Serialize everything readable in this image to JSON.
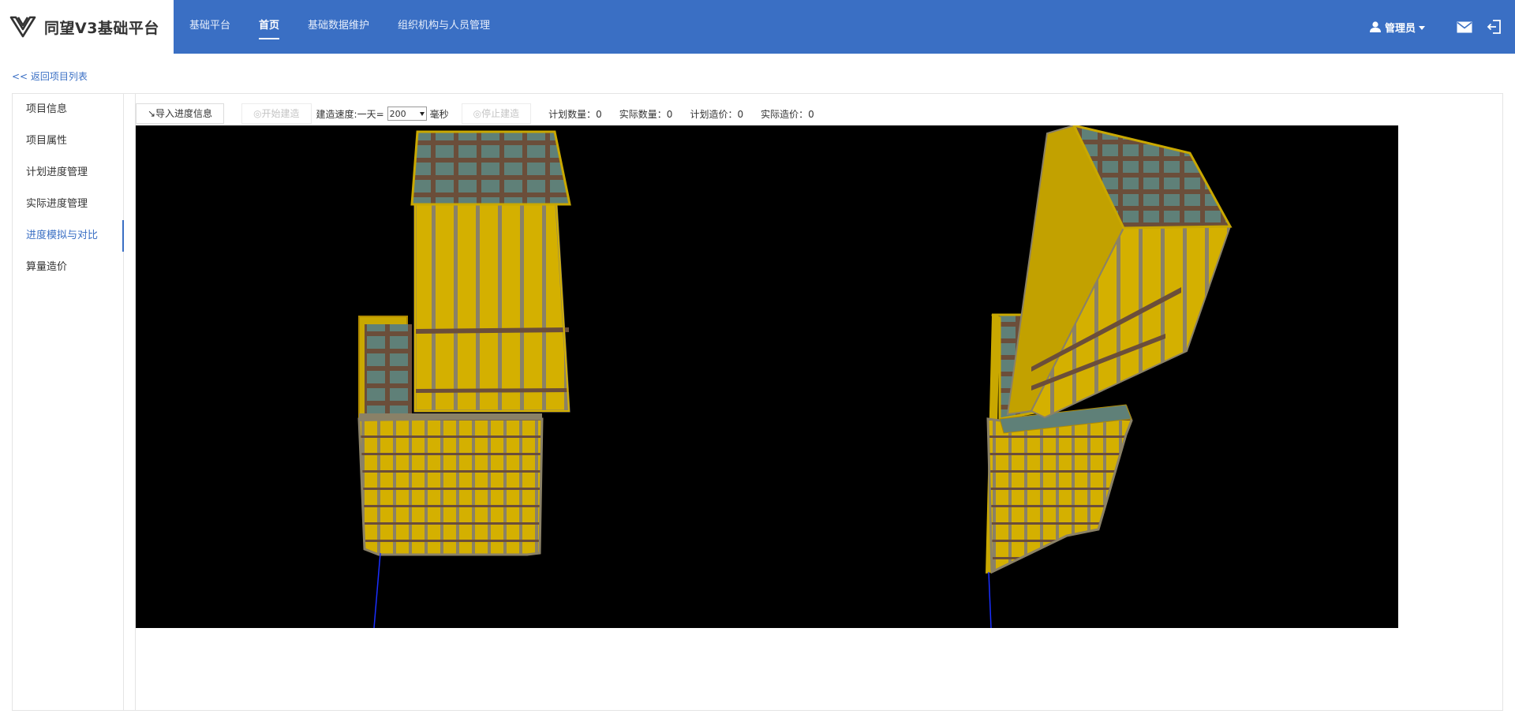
{
  "app": {
    "title": "同望V3基础平台"
  },
  "nav": {
    "items": [
      {
        "label": "基础平台"
      },
      {
        "label": "首页"
      },
      {
        "label": "基础数据维护"
      },
      {
        "label": "组织机构与人员管理"
      }
    ],
    "active_index": 1
  },
  "user": {
    "name": "管理员"
  },
  "back_link": "<< 返回项目列表",
  "sidebar": {
    "items": [
      {
        "label": "项目信息"
      },
      {
        "label": "项目属性"
      },
      {
        "label": "计划进度管理"
      },
      {
        "label": "实际进度管理"
      },
      {
        "label": "进度模拟与对比"
      },
      {
        "label": "算量造价"
      }
    ],
    "active_index": 4
  },
  "toolbar": {
    "import_label": "↘导入进度信息",
    "start_label": "◎开始建造",
    "speed_label": "建造速度:一天=",
    "speed_value": "200",
    "speed_unit": "毫秒",
    "stop_label": "◎停止建造",
    "planned_count": "计划数量：0",
    "actual_count": "实际数量：0",
    "planned_cost": "计划造价：0",
    "actual_cost": "实际造价：0"
  },
  "colors": {
    "accent": "#3a6fc4",
    "building_yellow": "#d4b000",
    "building_stripe": "#7b7462",
    "roof_tile": "#5f8078",
    "viewport_bg": "#000000"
  }
}
